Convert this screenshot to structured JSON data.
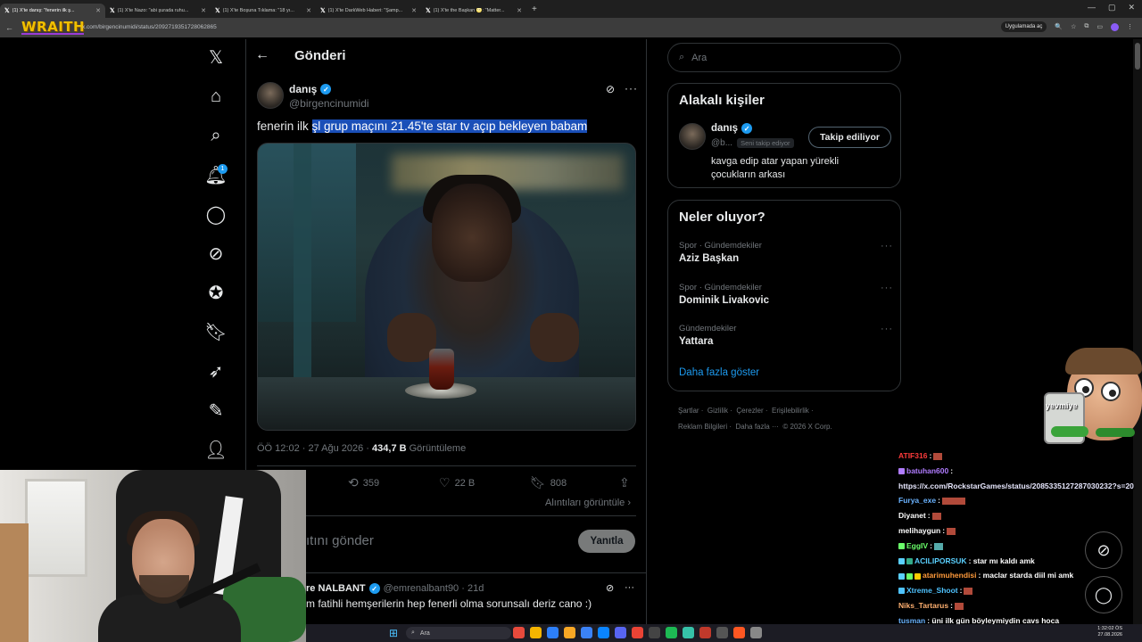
{
  "browser": {
    "tabs": [
      {
        "label": "(1) X'te danış: \"fenerin ilk ş...",
        "active": true
      },
      {
        "label": "(1) X'te Nazo: \"abi şurada ruhu...",
        "active": false
      },
      {
        "label": "(1) X'te Boşuna Tıklama: \"18 yı...",
        "active": false
      },
      {
        "label": "(1) X'te DarkWeb Haberi: \"Şamp...",
        "active": false
      },
      {
        "label": "(1) X'te the Başkan 🌝: \"Matter...",
        "active": false
      }
    ],
    "url": "x.com/birgencinumidi/status/2092719351728062865",
    "overlay_logo": "WRAITH",
    "app_button": "Uygulamada aç"
  },
  "sidebar": {
    "notifications_badge": "1",
    "items": [
      "x-logo",
      "home",
      "explore",
      "notifications",
      "messages",
      "grok",
      "verified",
      "bookmarks",
      "jobs",
      "premium",
      "profile"
    ]
  },
  "main": {
    "title": "Gönderi",
    "post": {
      "name": "danış",
      "handle": "@birgencinumidi",
      "text_prefix": "fenerin ilk ",
      "text_highlight": "şl grup maçını 21.45'te star tv açıp bekleyen babam",
      "time": "ÖÖ 12:02 · 27 Ağu 2026 · ",
      "views_num": "434,7 B",
      "views_label": " Görüntüleme",
      "retweets": "359",
      "likes": "22 B",
      "bookmarks": "808",
      "quotes": "Alıntıları görüntüle ›"
    },
    "reply_box": {
      "placeholder": "ıtını gönder",
      "button": "Yanıtla"
    },
    "reply": {
      "name": "re NALBANT",
      "handle": "@emrenalbant90 · 21d",
      "text": "m fatihli hemşerilerin hep fenerli olma sorunsalı deriz cano :)"
    }
  },
  "right": {
    "search_placeholder": "Ara",
    "relevant": {
      "title": "Alakalı kişiler",
      "name": "danış",
      "handle": "@b...",
      "follows_you": "Seni takip ediyor",
      "follow_button": "Takip ediliyor",
      "bio": "kavga edip atar yapan yürekli çocukların arkası"
    },
    "trends": {
      "title": "Neler oluyor?",
      "items": [
        {
          "category": "Spor · Gündemdekiler",
          "name": "Aziz Başkan"
        },
        {
          "category": "Spor · Gündemdekiler",
          "name": "Dominik Livakovic"
        },
        {
          "category": "Gündemdekiler",
          "name": "Yattara"
        }
      ],
      "show_more": "Daha fazla göster"
    },
    "footer": {
      "line1": [
        "Şartlar",
        "·",
        "Gizlilik",
        "·",
        "Çerezler",
        "·",
        "Erişilebilirlik",
        "·"
      ],
      "line2": [
        "Reklam Bilgileri",
        "·",
        "Daha fazla ···",
        "© 2026 X Corp."
      ]
    }
  },
  "stream": {
    "mascot_label": "yevmiye",
    "chat": [
      {
        "user": "ATIF316",
        "color": "#ff3b3b",
        "msg": ":",
        "emote": true
      },
      {
        "user": "batuhan600",
        "color": "#b07cff",
        "msg": ":",
        "emote": false
      },
      {
        "user": "",
        "color": "#ffffff",
        "msg": "https://x.com/RockstarGames/status/2085335127287030232?s=20",
        "emote": false,
        "link": true
      },
      {
        "user": "Furya_exe",
        "color": "#6ab3ff",
        "msg": ":",
        "emote": true,
        "wide": true
      },
      {
        "user": "Diyanet",
        "color": "#ffffff",
        "msg": ":",
        "emote": true
      },
      {
        "user": "melihaygun",
        "color": "#ffffff",
        "msg": ":",
        "emote": true
      },
      {
        "user": "EggIV",
        "color": "#6aff6a",
        "msg": ":",
        "emote": true
      },
      {
        "user": "ACILIPORSUK",
        "color": "#5ad0ff",
        "msg": ": star mı kaldı amk",
        "emote": false
      },
      {
        "user": "atarimuhendisi",
        "color": "#ff9a3b",
        "msg": ": maclar starda diil mi amk",
        "emote": false
      },
      {
        "user": "Xtreme_Shoot",
        "color": "#4fc3ff",
        "msg": ":",
        "emote": true
      },
      {
        "user": "Niks_Tartarus",
        "color": "#ffb070",
        "msg": ":",
        "emote": true
      },
      {
        "user": "tusman",
        "color": "#6ab3ff",
        "msg": ": üni ilk gün böyleymiydin cavs hoca",
        "emote": false
      }
    ]
  },
  "taskbar": {
    "search_placeholder": "Ara",
    "time": "1:32:02 ÖS",
    "date": "27.08.2026"
  }
}
